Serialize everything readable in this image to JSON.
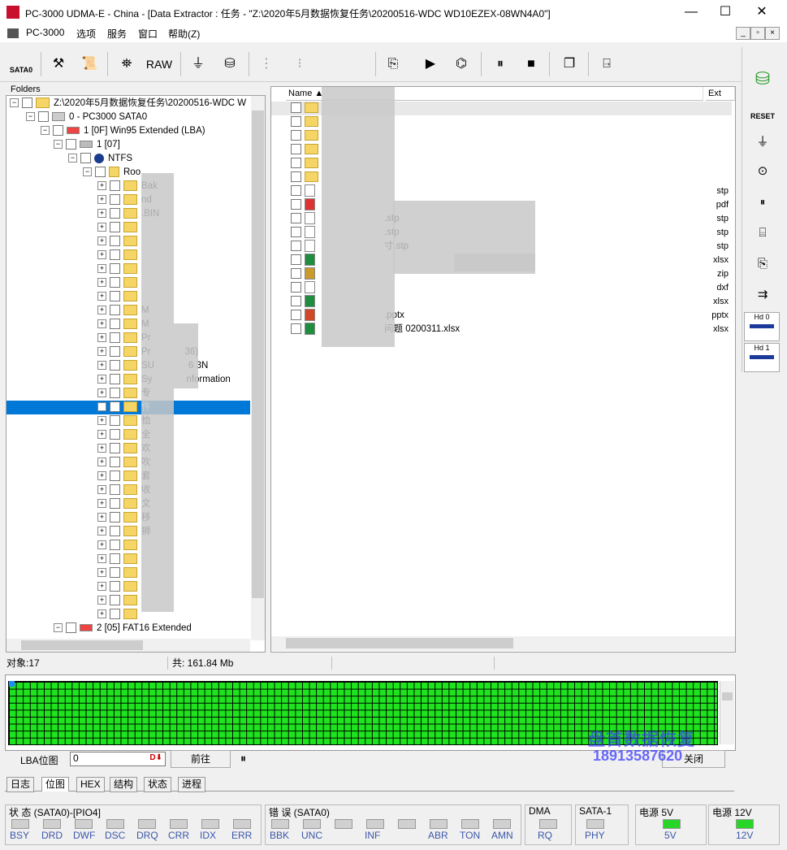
{
  "window": {
    "title": "PC-3000 UDMA-E - China - [Data Extractor : 任务 - \"Z:\\2020年5月数据恢复任务\\20200516-WDC WD10EZEX-08WN4A0\"]"
  },
  "menu": [
    "PC-3000",
    "选项",
    "服务",
    "窗口",
    "帮助(Z)"
  ],
  "toolbar": {
    "sata_label": "SATA0",
    "raw_label": "RAW"
  },
  "folders_panel": {
    "header": "Folders"
  },
  "tree": {
    "root": "Z:\\2020年5月数据恢复任务\\20200516-WDC W",
    "drive": "0 - PC3000 SATA0",
    "partition1": "1 [0F] Win95 Extended  (LBA)",
    "sub1": "1 [07]",
    "fs": "NTFS",
    "rootdir": "Roo",
    "items": [
      "Bak",
      "nd",
      ".BIN",
      "",
      "",
      "",
      "",
      "",
      "",
      "M",
      "M",
      "Pr",
      "Pr",
      "SU",
      "Sy",
      "专",
      "件",
      "恤",
      "全",
      "欢",
      "吹",
      "套",
      "收",
      "文",
      "移",
      "狮",
      "",
      "",
      "",
      "",
      "",
      ""
    ],
    "items_right": {
      "12": "36)",
      "13": "6 3N",
      "14": "nformation"
    },
    "partition2": "2 [05] FAT16 Extended"
  },
  "files_panel": {
    "col_name": "Name",
    "col_ext": "Ext",
    "rows": [
      {
        "name": "",
        "ext": ""
      },
      {
        "name": "",
        "ext": ""
      },
      {
        "name": "",
        "ext": ""
      },
      {
        "name": "",
        "ext": ""
      },
      {
        "name": "",
        "ext": ""
      },
      {
        "name": "",
        "ext": ""
      },
      {
        "name": "",
        "ext": "stp"
      },
      {
        "name": "",
        "ext": "pdf"
      },
      {
        "name": ".stp",
        "ext": "stp"
      },
      {
        "name": ".stp",
        "ext": "stp"
      },
      {
        "name": "寸.stp",
        "ext": "stp"
      },
      {
        "name": "",
        "ext": "xlsx"
      },
      {
        "name": "",
        "ext": "zip"
      },
      {
        "name": "",
        "ext": "dxf"
      },
      {
        "name": "",
        "ext": "xlsx"
      },
      {
        "name": ".pptx",
        "ext": "pptx"
      },
      {
        "name": "问题 0200311.xlsx",
        "ext": "xlsx"
      }
    ]
  },
  "statusbar": {
    "objects": "对象:17",
    "total": "共: 161.84 Mb"
  },
  "map": {
    "lba_label": "LBA位图",
    "lba_value": "0",
    "go_button": "前往",
    "watermark_name": "盘首数据恢复",
    "watermark_phone": "18913587620",
    "right_button": "关闭"
  },
  "tabs": [
    "日志",
    "位图",
    "HEX",
    "结构",
    "状态",
    "进程"
  ],
  "status_group": {
    "title": "状 态 (SATA0)-[PIO4]",
    "leds": [
      "BSY",
      "DRD",
      "DWF",
      "DSC",
      "DRQ",
      "CRR",
      "IDX",
      "ERR"
    ]
  },
  "error_group": {
    "title": "错 误 (SATA0)",
    "leds": [
      "BBK",
      "UNC",
      "",
      "INF",
      "",
      "ABR",
      "TON",
      "AMN"
    ]
  },
  "dma_group": {
    "title": "DMA",
    "leds": [
      "RQ"
    ]
  },
  "sata_group": {
    "title": "SATA-1",
    "leds": [
      "PHY"
    ]
  },
  "power5": {
    "title": "电源 5V",
    "led": "5V"
  },
  "power12": {
    "title": "电源 12V",
    "led": "12V"
  },
  "right_toolbar": {
    "reset": "RESET",
    "hd0": "Hd 0",
    "hd1": "Hd 1"
  },
  "colors": {
    "accent": "#0078d7",
    "led_on": "#28d628",
    "map_ok": "#1ee31e",
    "watermark": "#3a3aff"
  }
}
